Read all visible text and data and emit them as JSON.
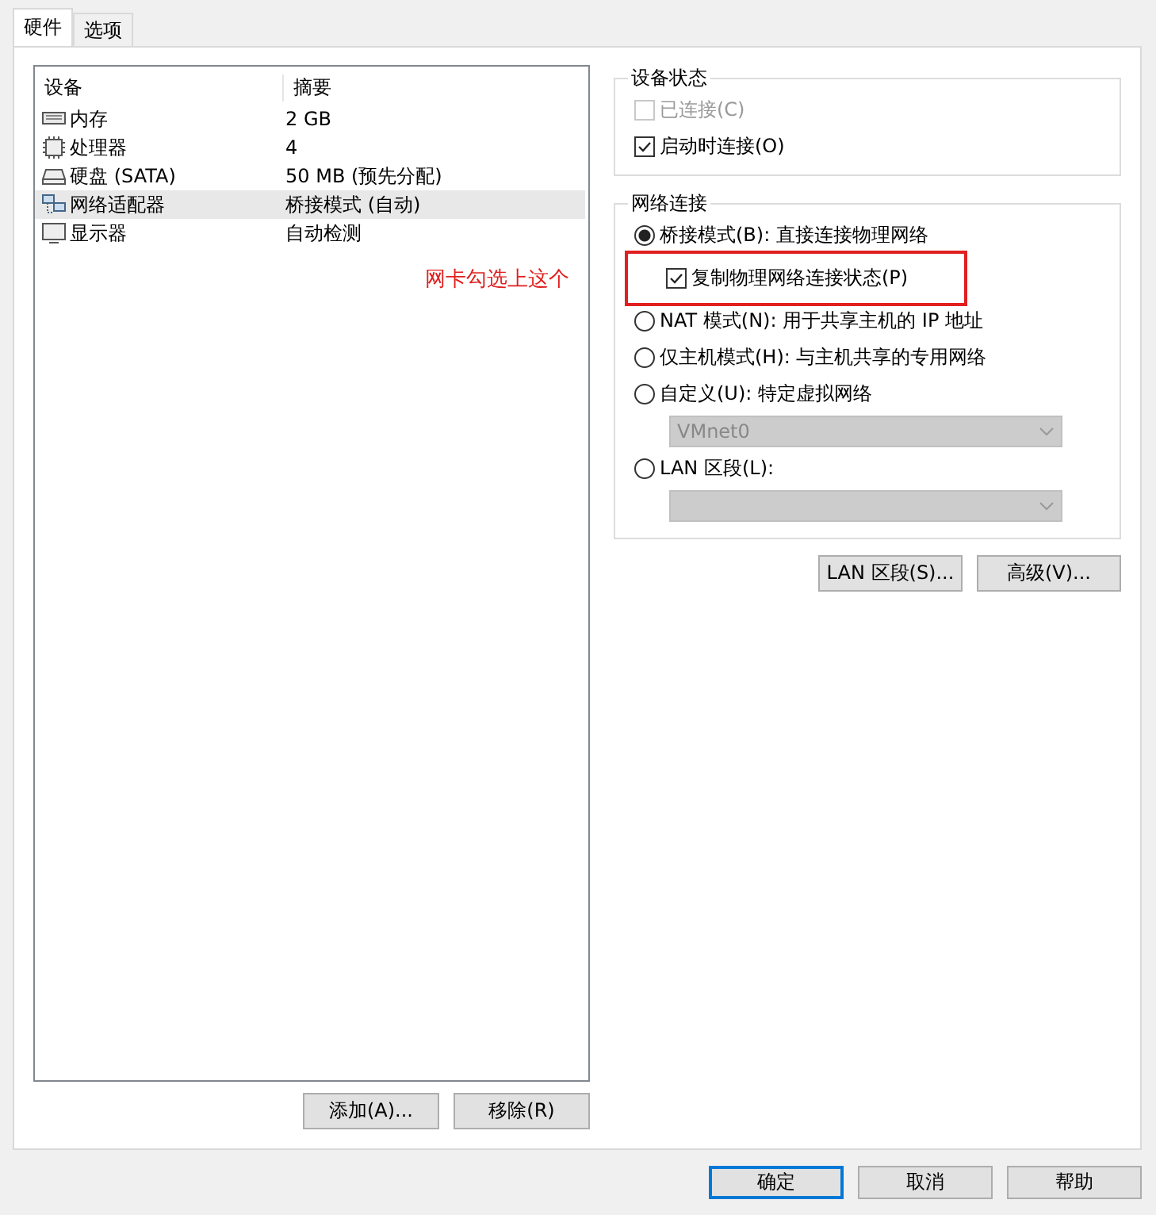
{
  "tabs": [
    {
      "label": "硬件",
      "selected": true
    },
    {
      "label": "选项",
      "selected": false
    }
  ],
  "device_list": {
    "columns": [
      "设备",
      "摘要"
    ],
    "rows": [
      {
        "kind": "memory",
        "device": "内存",
        "summary": "2 GB",
        "selected": false
      },
      {
        "kind": "cpu",
        "device": "处理器",
        "summary": "4",
        "selected": false
      },
      {
        "kind": "disk",
        "device": "硬盘 (SATA)",
        "summary": "50 MB (预先分配)",
        "selected": false
      },
      {
        "kind": "network",
        "device": "网络适配器",
        "summary": "桥接模式 (自动)",
        "selected": true
      },
      {
        "kind": "display",
        "device": "显示器",
        "summary": "自动检测",
        "selected": false
      }
    ]
  },
  "list_buttons": [
    "添加(A)...",
    "移除(R)"
  ],
  "annotation": "网卡勾选上这个",
  "device_status": {
    "title": "设备状态",
    "options": [
      {
        "label": "已连接(C)",
        "checked": false,
        "disabled": true
      },
      {
        "label": "启动时连接(O)",
        "checked": true,
        "disabled": false
      }
    ]
  },
  "network_connection": {
    "title": "网络连接",
    "items": [
      {
        "kind": "radio",
        "label": "桥接模式(B): 直接连接物理网络",
        "selected": true
      },
      {
        "kind": "checkbox",
        "label": "复制物理网络连接状态(P)",
        "checked": true,
        "highlighted": true
      },
      {
        "kind": "radio",
        "label": "NAT 模式(N): 用于共享主机的 IP 地址",
        "selected": false
      },
      {
        "kind": "radio",
        "label": "仅主机模式(H): 与主机共享的专用网络",
        "selected": false
      },
      {
        "kind": "radio",
        "label": "自定义(U): 特定虚拟网络",
        "selected": false
      },
      {
        "kind": "dropdown",
        "value": "VMnet0",
        "disabled": true
      },
      {
        "kind": "radio",
        "label": "LAN 区段(L):",
        "selected": false
      },
      {
        "kind": "dropdown",
        "disabled": true
      }
    ]
  },
  "network_buttons": [
    "LAN 区段(S)...",
    "高级(V)..."
  ],
  "dialog_buttons": [
    {
      "label": "确定",
      "default": true
    },
    {
      "label": "取消",
      "default": false
    },
    {
      "label": "帮助",
      "default": false
    }
  ]
}
